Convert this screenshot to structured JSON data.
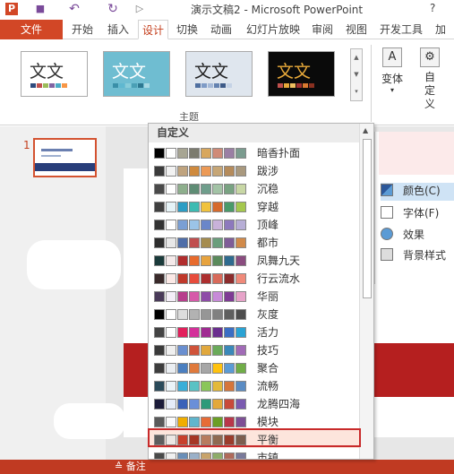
{
  "window": {
    "title": "演示文稿2 - Microsoft PowerPoint",
    "help": "?"
  },
  "quick_access": [
    {
      "icon": "powerpoint-logo-icon",
      "glyph": "P"
    },
    {
      "icon": "save-icon",
      "glyph": "■"
    },
    {
      "icon": "undo-icon",
      "glyph": "↶"
    },
    {
      "icon": "redo-icon",
      "glyph": "↻"
    },
    {
      "icon": "start-from-beginning-icon",
      "glyph": "▷"
    }
  ],
  "tabs": [
    "文件",
    "开始",
    "插入",
    "设计",
    "切换",
    "动画",
    "幻灯片放映",
    "审阅",
    "视图",
    "开发工具",
    "加"
  ],
  "active_tab": "设计",
  "ribbon": {
    "themes": [
      {
        "label": "文文",
        "text_color": "#333333",
        "bg": "#ffffff",
        "strip": [
          "#2e4a7d",
          "#c0504d",
          "#9bbb59",
          "#8064a2",
          "#4bacc6",
          "#f79646"
        ]
      },
      {
        "label": "文文",
        "text_color": "#ffffff",
        "bg": "#6fbdd1",
        "strip": [
          "#3a8fa8",
          "#5fb8d0",
          "#88ccd9",
          "#4a9fb5",
          "#2e7891",
          "#a9d9e4"
        ]
      },
      {
        "label": "文文",
        "text_color": "#222222",
        "bg": "#dfe6ee",
        "strip": [
          "#4f6fa0",
          "#7e9bc6",
          "#a5b9d7",
          "#6482b0",
          "#3d5a88",
          "#c5d3e6"
        ]
      },
      {
        "label": "文文",
        "text_color": "#e8a93a",
        "bg": "#0a0a0a",
        "strip": [
          "#c0504d",
          "#e8a93a",
          "#f0c060",
          "#a03030",
          "#d87a30",
          "#8a3020"
        ]
      }
    ],
    "gallery_scroll": [
      "▲",
      "▼",
      "▾"
    ],
    "group_label": "主题",
    "variants_label": "变体",
    "customize_label": "自定义"
  },
  "slide_panel": {
    "number": "1"
  },
  "design_pane": {
    "items": [
      {
        "label": "颜色(C)",
        "icon": "colors-icon"
      },
      {
        "label": "字体(F)",
        "icon": "fonts-icon"
      },
      {
        "label": "效果",
        "icon": "effects-icon"
      },
      {
        "label": "背景样式",
        "icon": "background-styles-icon"
      }
    ]
  },
  "status_bar": {
    "notes": "≙ 备注"
  },
  "dropdown": {
    "header": "自定义",
    "scroll_up": "▲",
    "selected_scheme": "平衡",
    "schemes": [
      {
        "name": "暗香扑面",
        "colors": [
          "#000000",
          "#ffffff",
          "#a7a593",
          "#7c7b6e",
          "#d8a75d",
          "#cf8a77",
          "#9a7fa4",
          "#7b9c8f"
        ]
      },
      {
        "name": "跋涉",
        "colors": [
          "#3b3b3b",
          "#f2f2f2",
          "#bfa37e",
          "#cf8a3e",
          "#ec9a56",
          "#c6a676",
          "#b58b5b",
          "#a9997e"
        ]
      },
      {
        "name": "沉稳",
        "colors": [
          "#4a4a4a",
          "#ffffff",
          "#8eaf8d",
          "#5f8d75",
          "#6f9e8c",
          "#a3c3a6",
          "#79a382",
          "#c8d7a5"
        ]
      },
      {
        "name": "穿越",
        "colors": [
          "#404040",
          "#e6f3f7",
          "#2d9dc4",
          "#3dbbb2",
          "#f0c23d",
          "#d66a2c",
          "#4a9a6a",
          "#a5c84e"
        ]
      },
      {
        "name": "顶峰",
        "colors": [
          "#333333",
          "#ffffff",
          "#7a9fd4",
          "#9bc4e8",
          "#6a86c9",
          "#c9b2d9",
          "#8d79bd",
          "#b7aed6"
        ]
      },
      {
        "name": "都市",
        "colors": [
          "#2e2e2e",
          "#e8e8e8",
          "#4f6ea8",
          "#c04e4e",
          "#a58c4e",
          "#6a9e7c",
          "#7f5d98",
          "#d18a4a"
        ]
      },
      {
        "name": "凤舞九天",
        "colors": [
          "#1a3a3a",
          "#f4eaea",
          "#b12d2d",
          "#e86b2d",
          "#e7a33e",
          "#5a8a5c",
          "#2f6b8f",
          "#8a4c7f"
        ]
      },
      {
        "name": "行云流水",
        "colors": [
          "#3a2a2a",
          "#fbe9e6",
          "#c0392b",
          "#e74c3c",
          "#ad2f2f",
          "#d86a5a",
          "#8c2c2c",
          "#f08a7a"
        ]
      },
      {
        "name": "华丽",
        "colors": [
          "#4a3b5a",
          "#f4eef8",
          "#b73e8c",
          "#d65aa9",
          "#8e4ca8",
          "#c78ad8",
          "#7e3b94",
          "#e7a3c9"
        ]
      },
      {
        "name": "灰度",
        "colors": [
          "#000000",
          "#ffffff",
          "#dddddd",
          "#b2b2b2",
          "#969696",
          "#808080",
          "#5f5f5f",
          "#4d4d4d"
        ]
      },
      {
        "name": "活力",
        "colors": [
          "#444444",
          "#ffffff",
          "#e2205c",
          "#d4319a",
          "#a02b92",
          "#6a2f8f",
          "#3b6ec4",
          "#2aa3d4"
        ]
      },
      {
        "name": "技巧",
        "colors": [
          "#3a3a3a",
          "#f0f0f0",
          "#6a8fd0",
          "#d0533a",
          "#e1a83d",
          "#6aaa5a",
          "#3a88b9",
          "#a16bb7"
        ]
      },
      {
        "name": "聚合",
        "colors": [
          "#3d3d3d",
          "#eaeef2",
          "#4b7fc0",
          "#e07a3c",
          "#a6a6a6",
          "#ffc20e",
          "#5b9bd5",
          "#70ad47"
        ]
      },
      {
        "name": "流畅",
        "colors": [
          "#2a4a5a",
          "#eaf3f8",
          "#3aaed8",
          "#59c2c4",
          "#8ac65a",
          "#e3b93a",
          "#d6763a",
          "#5a8cc4"
        ]
      },
      {
        "name": "龙腾四海",
        "colors": [
          "#1c1c3a",
          "#e6ecf8",
          "#3a62b8",
          "#6a8fd8",
          "#2c9a7a",
          "#e3a83a",
          "#c84a3a",
          "#7a5ab0"
        ]
      },
      {
        "name": "模块",
        "colors": [
          "#5a5a5a",
          "#fafafa",
          "#f0ad00",
          "#60b5cc",
          "#e66c37",
          "#6b9f25",
          "#b9374a",
          "#7d4f95"
        ]
      },
      {
        "name": "平衡",
        "colors": [
          "#5e5e5e",
          "#ece7e4",
          "#c8402c",
          "#a63624",
          "#b87b5e",
          "#8f6a52",
          "#9b3d2c",
          "#7d5e4f"
        ]
      },
      {
        "name": "市镇",
        "colors": [
          "#4a4a4a",
          "#f0f0f0",
          "#6a8fb8",
          "#9ab0c8",
          "#c8a36a",
          "#8eac6a",
          "#b06a5a",
          "#7a7a9a"
        ]
      }
    ]
  }
}
